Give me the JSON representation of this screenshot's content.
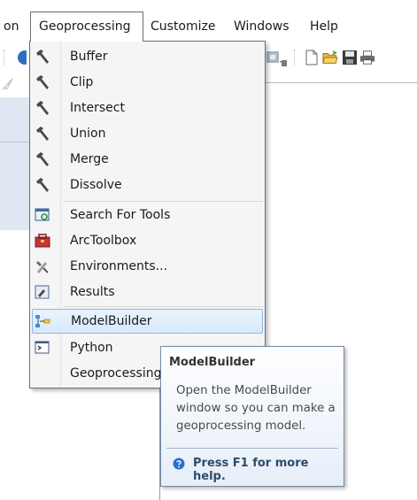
{
  "menubar": {
    "partial_left": "on",
    "items": [
      "Geoprocessing",
      "Customize",
      "Windows",
      "Help"
    ]
  },
  "geoprocessing_menu": {
    "items": [
      {
        "label": "Buffer",
        "icon": "hammer-icon"
      },
      {
        "label": "Clip",
        "icon": "hammer-icon"
      },
      {
        "label": "Intersect",
        "icon": "hammer-icon"
      },
      {
        "label": "Union",
        "icon": "hammer-icon"
      },
      {
        "label": "Merge",
        "icon": "hammer-icon"
      },
      {
        "label": "Dissolve",
        "icon": "hammer-icon"
      },
      {
        "label": "Search For Tools",
        "icon": "search-tools-icon"
      },
      {
        "label": "ArcToolbox",
        "icon": "toolbox-icon"
      },
      {
        "label": "Environments...",
        "icon": "environments-icon"
      },
      {
        "label": "Results",
        "icon": "results-icon"
      },
      {
        "label": "ModelBuilder",
        "icon": "modelbuilder-icon",
        "highlighted": true
      },
      {
        "label": "Python",
        "icon": "python-window-icon"
      },
      {
        "label": "Geoprocessing",
        "icon": ""
      }
    ]
  },
  "tooltip": {
    "title": "ModelBuilder",
    "description": "Open the ModelBuilder window so you can make a geoprocessing model.",
    "help": "Press F1 for more help."
  },
  "colors": {
    "highlight_border": "#8eb6e4",
    "highlight_fill": "#d8e9fb",
    "menu_background": "#f5f5f5",
    "tooltip_border": "#768ca8"
  }
}
